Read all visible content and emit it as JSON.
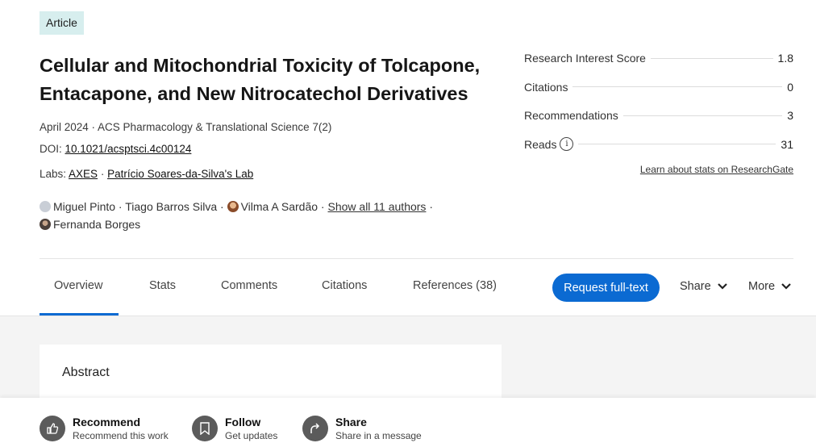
{
  "article": {
    "badge": "Article",
    "title": "Cellular and Mitochondrial Toxicity of Tolcapone, Entacapone, and New Nitrocatechol Derivatives",
    "date_journal": "April 2024 · ACS Pharmacology & Translational Science 7(2)",
    "doi_label": "DOI: ",
    "doi": "10.1021/acsptsci.4c00124",
    "labs_label": "Labs: ",
    "labs": [
      "AXES",
      "Patrício Soares-da-Silva's Lab"
    ],
    "lab_sep": " · ",
    "authors": [
      {
        "name": "Miguel Pinto",
        "avatar": "placeholder-avatar"
      },
      {
        "name": "Tiago Barros Silva"
      },
      {
        "name": "Vilma A Sardão",
        "avatar": "photo-avatar"
      },
      {
        "name": "Fernanda Borges",
        "avatar": "photo-avatar"
      }
    ],
    "sep": " · ",
    "show_all": "Show all 11 authors"
  },
  "stats": {
    "items": [
      {
        "label": "Research Interest Score",
        "value": "1.8"
      },
      {
        "label": "Citations",
        "value": "0"
      },
      {
        "label": "Recommendations",
        "value": "3"
      },
      {
        "label": "Reads",
        "value": "31",
        "icon": "info-icon"
      }
    ],
    "learn_link": "Learn about stats on ResearchGate"
  },
  "tabs": [
    {
      "label": "Overview",
      "active": true
    },
    {
      "label": "Stats"
    },
    {
      "label": "Comments"
    },
    {
      "label": "Citations"
    },
    {
      "label": "References (38)"
    }
  ],
  "actions": {
    "request": "Request full-text",
    "share": "Share",
    "more": "More"
  },
  "abstract": {
    "title": "Abstract"
  },
  "bottom_bar": [
    {
      "label": "Recommend",
      "sub": "Recommend this work",
      "icon": "thumbs-up-icon"
    },
    {
      "label": "Follow",
      "sub": "Get updates",
      "icon": "bookmark-icon"
    },
    {
      "label": "Share",
      "sub": "Share in a message",
      "icon": "share-arrow-icon"
    }
  ],
  "colors": {
    "accent": "#0b6ad2",
    "badge_bg": "#d7eeee",
    "content_bg": "#f4f4f4",
    "icon_circle": "#5b5b5b"
  }
}
